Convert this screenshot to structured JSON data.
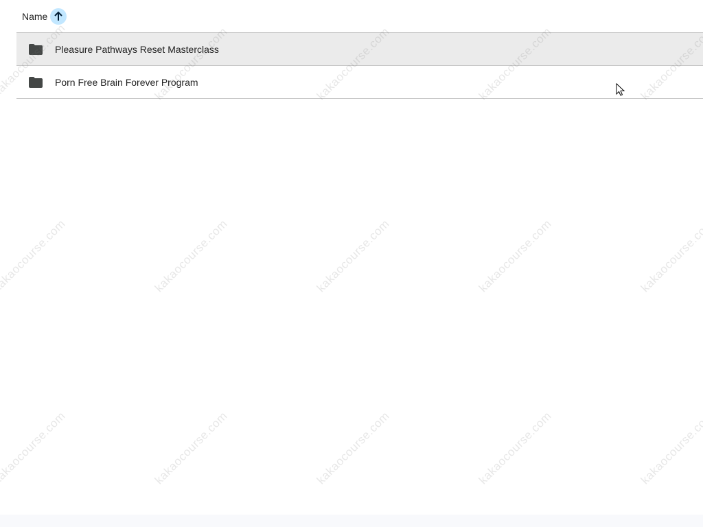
{
  "header": {
    "name_label": "Name",
    "sort_direction": "ascending"
  },
  "files": [
    {
      "name": "Pleasure Pathways Reset Masterclass",
      "type": "folder",
      "selected": true
    },
    {
      "name": "Porn Free Brain Forever Program",
      "type": "folder",
      "selected": false
    }
  ],
  "watermark": {
    "text": "kakaocourse.com"
  },
  "colors": {
    "sort_button_bg": "#c2e7ff",
    "sort_arrow": "#001d35",
    "selected_row_bg": "#ebebeb",
    "folder_icon": "#444746",
    "divider": "#c7c7c7"
  },
  "icons": {
    "sort": "arrow-up-icon",
    "folder": "folder-icon",
    "cursor": "mouse-pointer-icon"
  }
}
